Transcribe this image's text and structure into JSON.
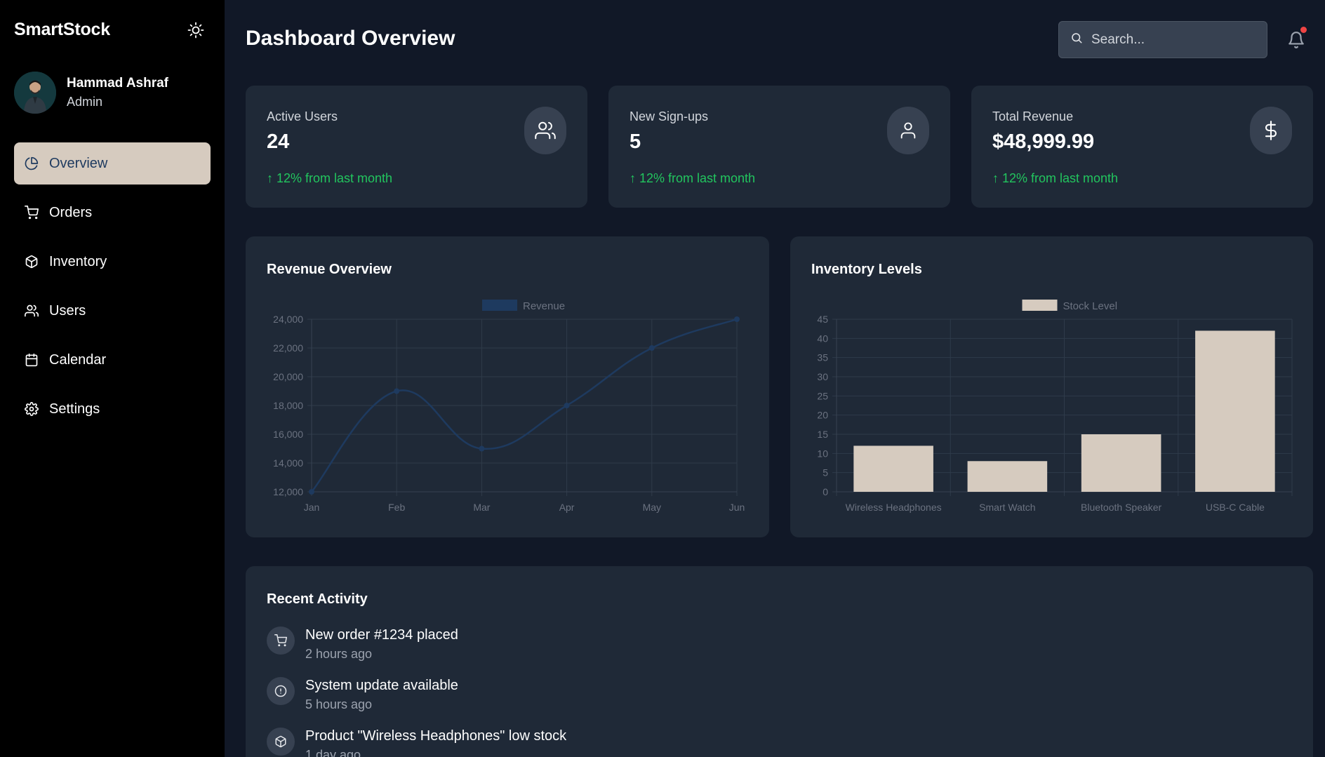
{
  "sidebar": {
    "brand": "SmartStock",
    "theme_icon": "sun-icon",
    "user": {
      "name": "Hammad Ashraf",
      "role": "Admin"
    },
    "items": [
      {
        "label": "Overview",
        "icon": "pie-chart-icon",
        "active": true
      },
      {
        "label": "Orders",
        "icon": "cart-icon",
        "active": false
      },
      {
        "label": "Inventory",
        "icon": "package-icon",
        "active": false
      },
      {
        "label": "Users",
        "icon": "users-icon",
        "active": false
      },
      {
        "label": "Calendar",
        "icon": "calendar-icon",
        "active": false
      },
      {
        "label": "Settings",
        "icon": "gear-icon",
        "active": false
      }
    ]
  },
  "header": {
    "title": "Dashboard Overview",
    "search_placeholder": "Search...",
    "notification_icon": "bell-icon"
  },
  "stats": [
    {
      "label": "Active Users",
      "value": "24",
      "change": "↑ 12% from last month",
      "icon": "users-icon"
    },
    {
      "label": "New Sign-ups",
      "value": "5",
      "change": "↑ 12% from last month",
      "icon": "user-icon"
    },
    {
      "label": "Total Revenue",
      "value": "$48,999.99",
      "change": "↑ 12% from last month",
      "icon": "dollar-icon"
    }
  ],
  "chart_data": [
    {
      "type": "line",
      "title": "Revenue Overview",
      "categories": [
        "Jan",
        "Feb",
        "Mar",
        "Apr",
        "May",
        "Jun"
      ],
      "series": [
        {
          "name": "Revenue",
          "values": [
            12000,
            19000,
            15000,
            18000,
            22000,
            24000
          ]
        }
      ],
      "y_ticks": [
        "24,000",
        "22,000",
        "20,000",
        "18,000",
        "16,000",
        "14,000",
        "12,000"
      ],
      "ylim": [
        12000,
        24000
      ],
      "grid": true,
      "legend": "top",
      "color": "#1e3a5f"
    },
    {
      "type": "bar",
      "title": "Inventory Levels",
      "categories": [
        "Wireless Headphones",
        "Smart Watch",
        "Bluetooth Speaker",
        "USB-C Cable"
      ],
      "series": [
        {
          "name": "Stock Level",
          "values": [
            12,
            8,
            15,
            42
          ]
        }
      ],
      "y_ticks": [
        "45",
        "40",
        "35",
        "30",
        "25",
        "20",
        "15",
        "10",
        "5",
        "0"
      ],
      "ylim": [
        0,
        45
      ],
      "grid": true,
      "legend": "top",
      "color": "#d6cbbf"
    }
  ],
  "activity": {
    "title": "Recent Activity",
    "items": [
      {
        "title": "New order #1234 placed",
        "time": "2 hours ago",
        "icon": "cart-icon"
      },
      {
        "title": "System update available",
        "time": "5 hours ago",
        "icon": "alert-circle-icon"
      },
      {
        "title": "Product \"Wireless Headphones\" low stock",
        "time": "1 day ago",
        "icon": "package-icon"
      }
    ]
  }
}
